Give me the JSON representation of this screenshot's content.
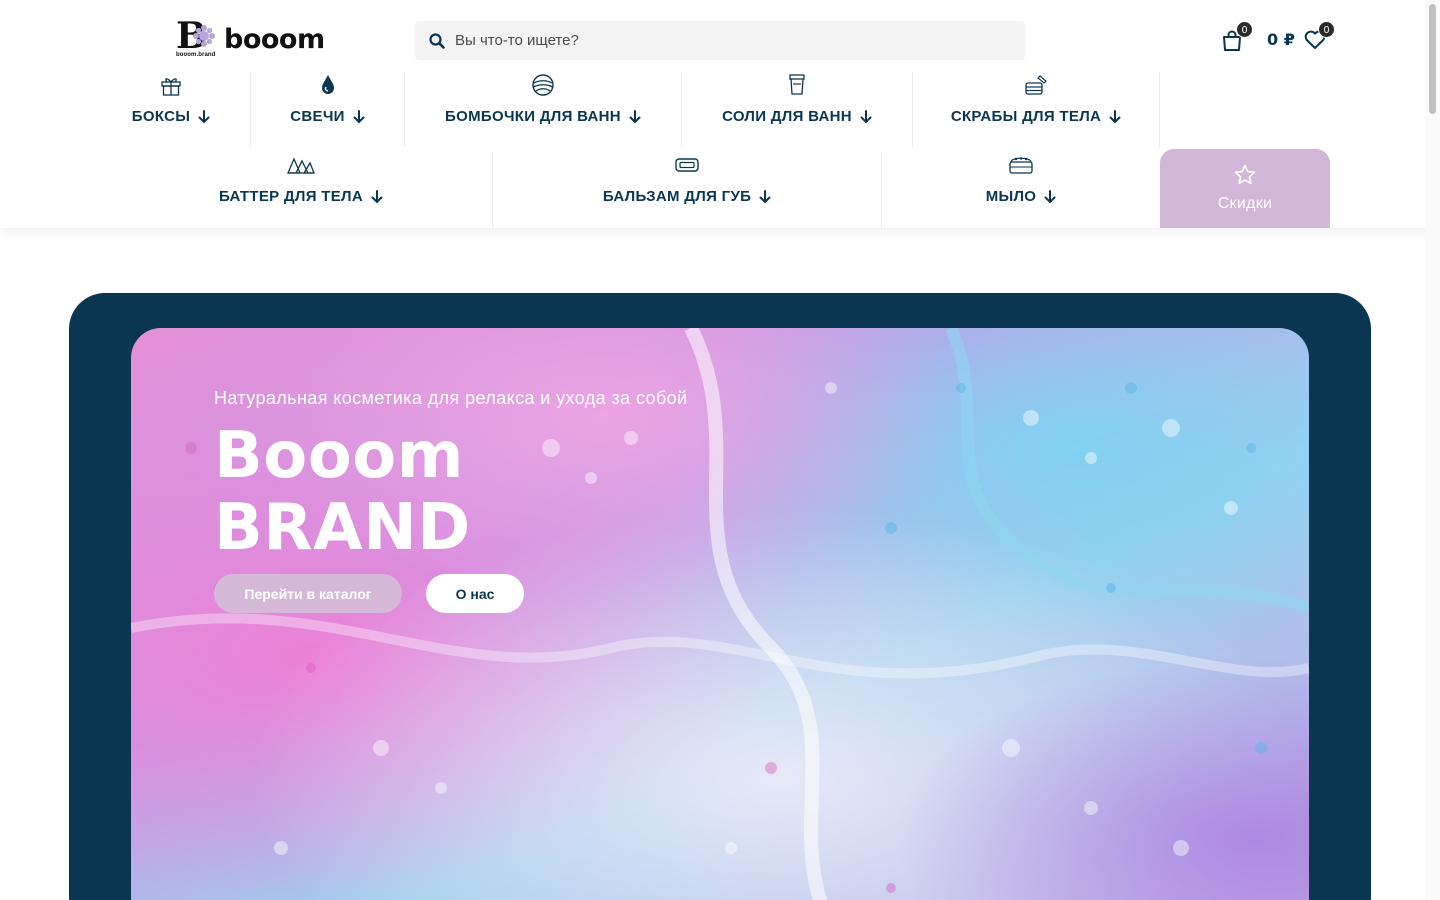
{
  "header": {
    "logo_text": "booom",
    "logo_subtext": "booom.brand",
    "search_placeholder": "Вы что-то ищете?",
    "cart_count": "0",
    "cart_total": "0 ₽",
    "wishlist_count": "0"
  },
  "nav": {
    "row1": [
      {
        "label": "БОКСЫ",
        "icon": "gift-icon"
      },
      {
        "label": "СВЕЧИ",
        "icon": "drop-icon"
      },
      {
        "label": "БОМБОЧКИ ДЛЯ ВАНН",
        "icon": "bath-bomb-icon"
      },
      {
        "label": "СОЛИ ДЛЯ ВАНН",
        "icon": "jar-icon"
      },
      {
        "label": "СКРАБЫ ДЛЯ ТЕЛА",
        "icon": "scrub-icon"
      }
    ],
    "row2": [
      {
        "label": "БАТТЕР ДЛЯ ТЕЛА",
        "icon": "butter-icon"
      },
      {
        "label": "БАЛЬЗАМ ДЛЯ ГУБ",
        "icon": "lip-balm-icon"
      },
      {
        "label": "МЫЛО",
        "icon": "soap-icon"
      }
    ],
    "sale_label": "Скидки"
  },
  "hero": {
    "subtitle": "Натуральная косметика для релакса и ухода за собой",
    "title_line1": "Booom",
    "title_line2": "BRAND",
    "catalog_button": "Перейти в каталог",
    "about_button": "О нас"
  },
  "colors": {
    "primary": "#0b3651",
    "accent": "#d2b7d8",
    "search_bg": "#f3f3f3"
  }
}
